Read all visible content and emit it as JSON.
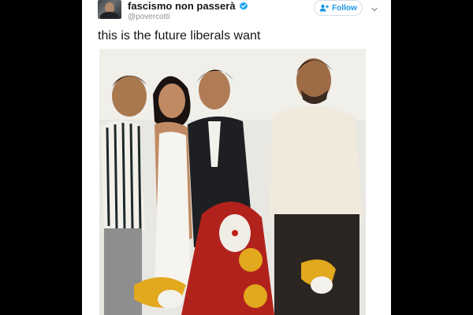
{
  "tweet": {
    "display_name": "fascismo non passerà",
    "handle": "@povercotti",
    "follow_label": "Follow",
    "text": "this is the future liberals want",
    "verified": true,
    "accent_color": "#1b95e0"
  },
  "icons": {
    "verified": "verified-badge-icon",
    "follow": "add-user-icon",
    "more": "chevron-down-icon"
  }
}
